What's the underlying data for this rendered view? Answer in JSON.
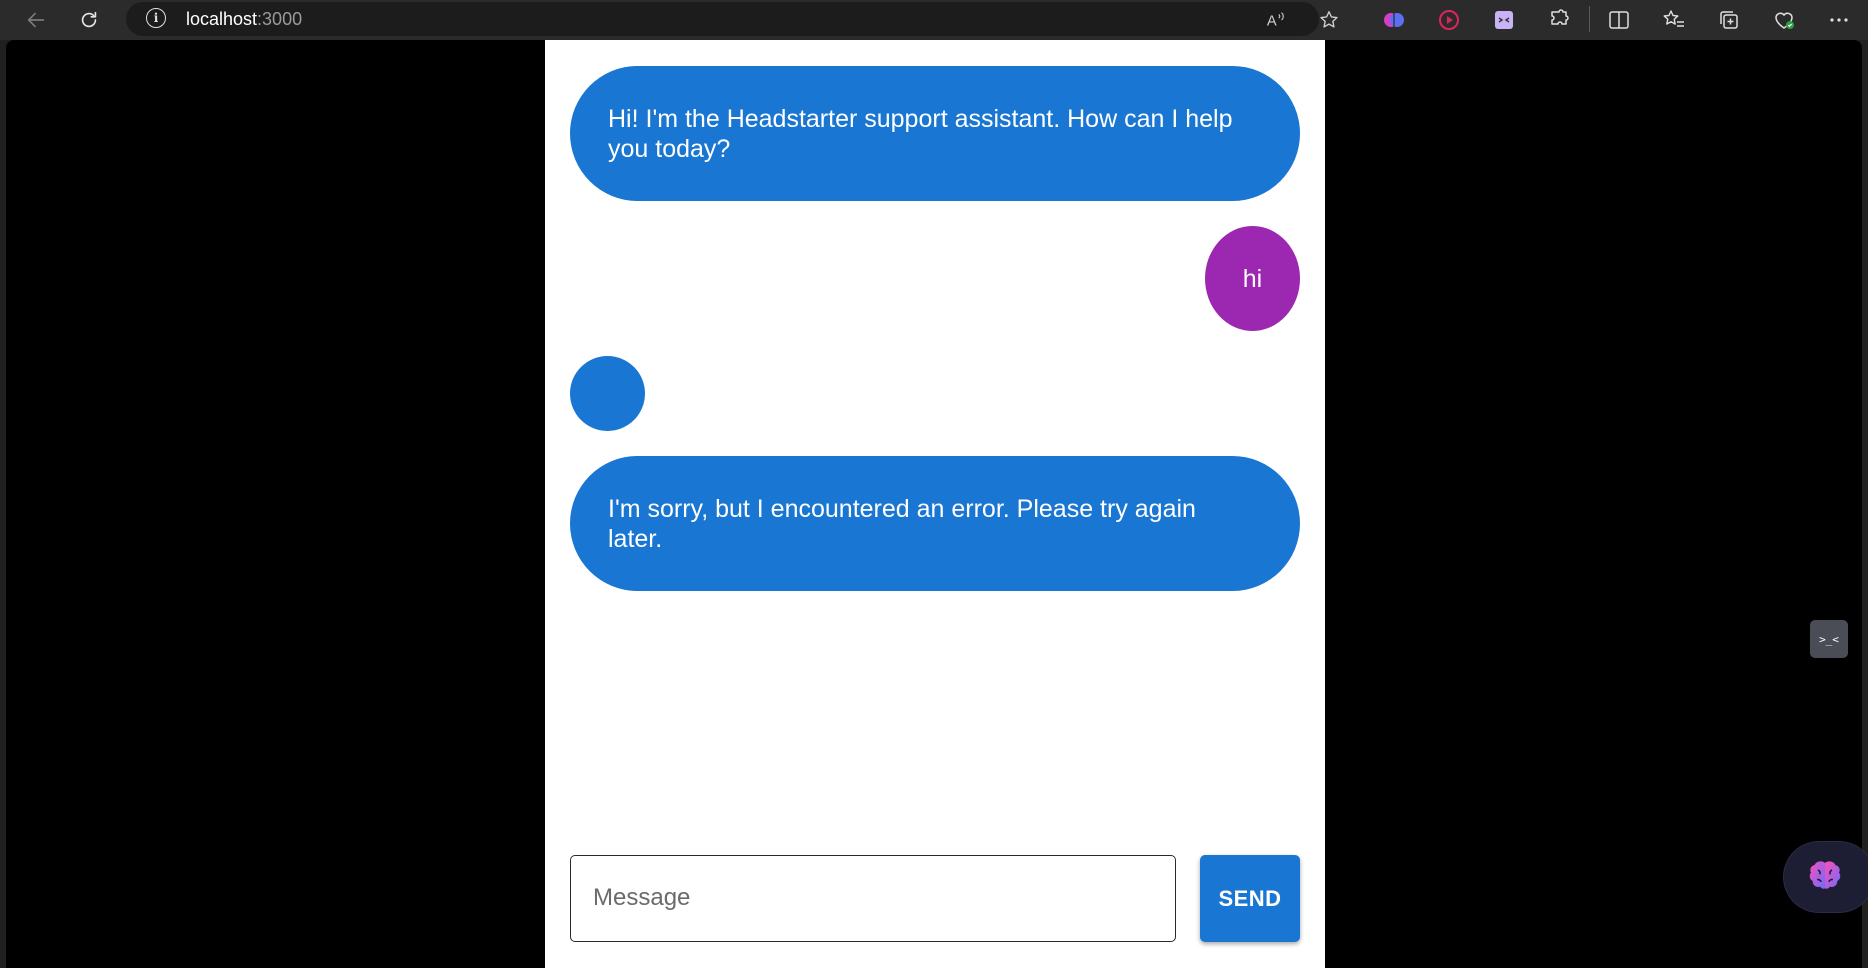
{
  "browser": {
    "url_host": "localhost",
    "url_port": ":3000"
  },
  "chat": {
    "messages": [
      {
        "role": "assistant",
        "text": "Hi! I'm the Headstarter support assistant. How can I help you today?"
      },
      {
        "role": "user",
        "text": "hi"
      },
      {
        "role": "assistant",
        "text": ""
      },
      {
        "role": "assistant",
        "text": "I'm sorry, but I encountered an error. Please try again later."
      }
    ],
    "input_placeholder": "Message",
    "input_value": "",
    "send_label": "SEND"
  },
  "colors": {
    "assistant_bubble": "#1976d2",
    "user_bubble": "#9c27b0",
    "send_button": "#1976d2",
    "viewport_background": "#000000",
    "panel_background": "#ffffff"
  },
  "icons": {
    "side_widget": "devtools-face-icon",
    "fab": "brain-icon"
  },
  "side_widget_label": ">_<"
}
